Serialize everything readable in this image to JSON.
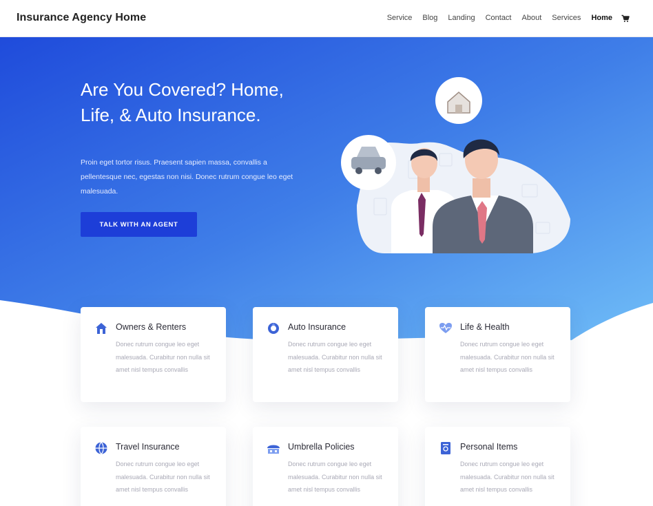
{
  "header": {
    "logo": "Insurance Agency Home",
    "nav": [
      "Service",
      "Blog",
      "Landing",
      "Contact",
      "About",
      "Services",
      "Home"
    ],
    "active": "Home",
    "cart_icon": "cart-icon"
  },
  "hero": {
    "title": "Are You Covered? Home, Life, & Auto Insurance.",
    "text": "Proin eget tortor risus. Praesent sapien massa, convallis a pellentesque nec, egestas non nisi. Donec rutrum congue leo eget malesuada.",
    "button": "TALK WITH AN AGENT"
  },
  "cards": [
    {
      "title": "Owners & Renters",
      "icon": "house-icon",
      "text": "Donec rutrum congue leo eget malesuada. Curabitur non nulla sit amet nisl tempus convallis"
    },
    {
      "title": "Auto Insurance",
      "icon": "car-icon",
      "text": "Donec rutrum congue leo eget malesuada. Curabitur non nulla sit amet nisl tempus convallis"
    },
    {
      "title": "Life & Health",
      "icon": "heart-icon",
      "text": "Donec rutrum congue leo eget malesuada. Curabitur non nulla sit amet nisl tempus convallis"
    },
    {
      "title": "Travel Insurance",
      "icon": "globe-icon",
      "text": "Donec rutrum congue leo eget malesuada. Curabitur non nulla sit amet nisl tempus convallis"
    },
    {
      "title": "Umbrella Policies",
      "icon": "umbrella-icon",
      "text": "Donec rutrum congue leo eget malesuada. Curabitur non nulla sit amet nisl tempus convallis"
    },
    {
      "title": "Personal Items",
      "icon": "document-icon",
      "text": "Donec rutrum congue leo eget malesuada. Curabitur non nulla sit amet nisl tempus convallis"
    }
  ],
  "colors": {
    "hero_start": "#2151dc",
    "hero_end": "#6bb8f6",
    "button": "#1d3ed8",
    "icon_accent": "#3c63d6"
  }
}
